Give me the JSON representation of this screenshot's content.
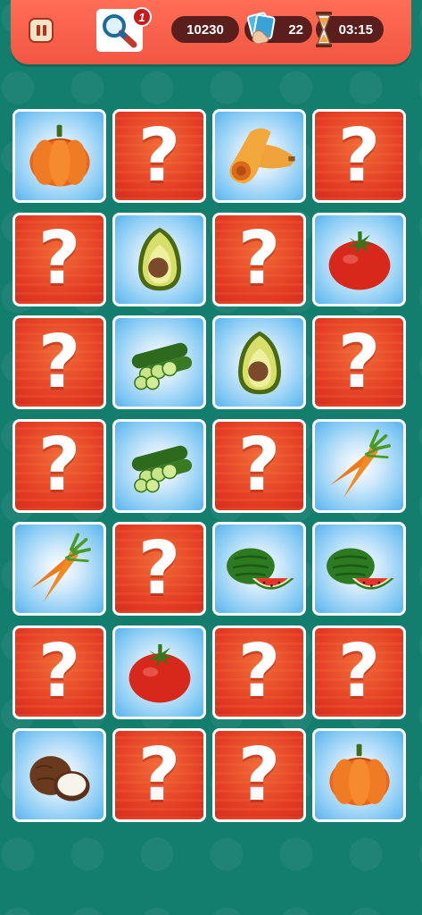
{
  "hud": {
    "pause_icon": "pause-icon",
    "hint_icon": "magnifier-icon",
    "hint_count": "1",
    "score": "10230",
    "moves_icon": "cards-hand-icon",
    "moves": "22",
    "timer_icon": "hourglass-icon",
    "timer": "03:15"
  },
  "colors": {
    "background": "#137d6e",
    "topbar": "#f25643",
    "pill": "#5a1f1c",
    "card_back": "#e6402a",
    "card_face": "#7cc6f3"
  },
  "hidden_symbol": "?",
  "board": {
    "columns": 4,
    "rows": 7,
    "cards": [
      {
        "state": "revealed",
        "item": "pumpkin"
      },
      {
        "state": "hidden"
      },
      {
        "state": "revealed",
        "item": "butternut-squash"
      },
      {
        "state": "hidden"
      },
      {
        "state": "hidden"
      },
      {
        "state": "revealed",
        "item": "avocado"
      },
      {
        "state": "hidden"
      },
      {
        "state": "revealed",
        "item": "tomato"
      },
      {
        "state": "hidden"
      },
      {
        "state": "revealed",
        "item": "cucumber"
      },
      {
        "state": "revealed",
        "item": "avocado"
      },
      {
        "state": "hidden"
      },
      {
        "state": "hidden"
      },
      {
        "state": "revealed",
        "item": "cucumber"
      },
      {
        "state": "hidden"
      },
      {
        "state": "revealed",
        "item": "carrot"
      },
      {
        "state": "revealed",
        "item": "carrot"
      },
      {
        "state": "hidden"
      },
      {
        "state": "revealed",
        "item": "watermelon"
      },
      {
        "state": "revealed",
        "item": "watermelon"
      },
      {
        "state": "hidden"
      },
      {
        "state": "revealed",
        "item": "tomato"
      },
      {
        "state": "hidden"
      },
      {
        "state": "hidden"
      },
      {
        "state": "revealed",
        "item": "coconut"
      },
      {
        "state": "hidden"
      },
      {
        "state": "hidden"
      },
      {
        "state": "revealed",
        "item": "pumpkin"
      }
    ]
  }
}
